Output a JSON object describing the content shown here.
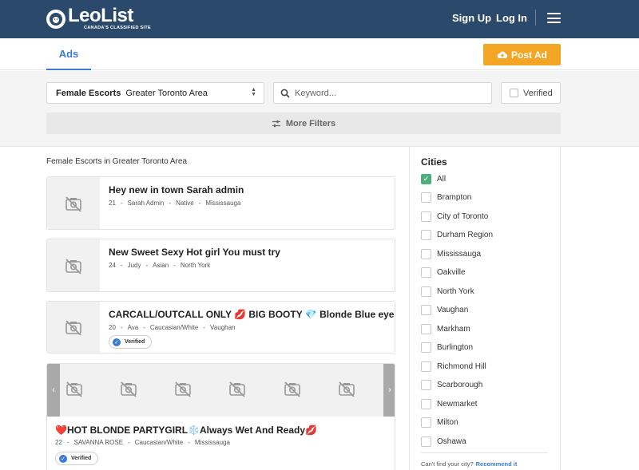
{
  "header": {
    "logo_name": "LeoList",
    "logo_tagline": "CANADA'S CLASSIFIED SITE",
    "signup_label": "Sign Up",
    "login_label": "Log In"
  },
  "tabs": {
    "ads_label": "Ads",
    "post_ad_label": "Post Ad"
  },
  "filters": {
    "category": "Female Escorts",
    "location": "Greater Toronto Area",
    "keyword_placeholder": "Keyword...",
    "verified_label": "Verified",
    "more_filters_label": "More Filters"
  },
  "breadcrumb": "Female Escorts in Greater Toronto Area",
  "listings": [
    {
      "title": "Hey new in town Sarah admin",
      "age": "21",
      "name": "Sarah Admin",
      "ethnicity": "Native",
      "city": "Mississauga",
      "verified": false
    },
    {
      "title": "New Sweet Sexy Hot girl You must try",
      "age": "24",
      "name": "Judy",
      "ethnicity": "Asian",
      "city": "North York",
      "verified": false
    },
    {
      "title": "CARCALL/OUTCALL ONLY 💋 BIG BOOTY 💎 Blonde Blue eyes💎",
      "age": "20",
      "name": "Ava",
      "ethnicity": "Caucasian/White",
      "city": "Vaughan",
      "verified": true
    },
    {
      "title": "❤️HOT BLONDE PARTYGIRL❄️Always Wet And Ready💋",
      "age": "22",
      "name": "SAVANNA ROSE",
      "ethnicity": "Caucasian/White",
      "city": "Mississauga",
      "verified": true
    }
  ],
  "verified_badge_label": "Verified",
  "sidebar": {
    "title": "Cities",
    "cities": [
      "All",
      "Brampton",
      "City of Toronto",
      "Durham Region",
      "Mississauga",
      "Oakville",
      "North York",
      "Vaughan",
      "Markham",
      "Burlington",
      "Richmond Hill",
      "Scarborough",
      "Newmarket",
      "Milton",
      "Oshawa"
    ],
    "cant_find_text": "Can't find your city?",
    "recommend_label": "Recommend it"
  },
  "colors": {
    "header_bg": "#2b4a6b",
    "accent_blue": "#3a7bd5",
    "post_ad_orange": "#f5a524",
    "check_green": "#4caf7d"
  },
  "icons": {
    "no_image": "no-photo-icon",
    "search": "search-icon",
    "filters": "sliders-icon",
    "upload": "cloud-upload-icon",
    "menu": "hamburger-icon"
  }
}
